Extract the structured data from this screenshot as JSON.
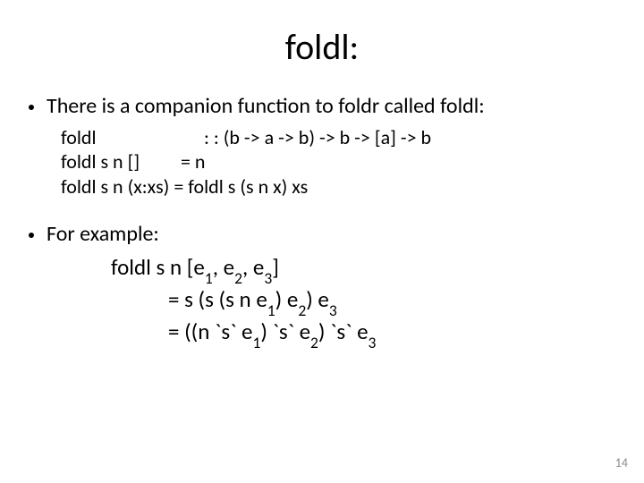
{
  "title": "foldl:",
  "bullet1": {
    "prefix": "There is a companion function to  ",
    "fn1": "foldr",
    "middle": " called ",
    "fn2": "foldl",
    "suffix": ":"
  },
  "code": {
    "l1a": "foldl",
    "l1b": ": : (b -> a -> b) -> b -> [a] -> b",
    "l2a": "foldl s n []",
    "l2b": "= n",
    "l3": "foldl s n (x:xs) = foldl s (s n x) xs"
  },
  "bullet2": "For example:",
  "example": {
    "e1_pre": "foldl s n [e",
    "e1_sub1": "1",
    "e1_mid1": ", e",
    "e1_sub2": "2",
    "e1_mid2": ", e",
    "e1_sub3": "3",
    "e1_post": "]",
    "e2_pre": "= s (s (s n e",
    "e2_sub1": "1",
    "e2_mid1": ") e",
    "e2_sub2": "2",
    "e2_mid2": ") e",
    "e2_sub3": "3",
    "e3_pre": "= ((n `s` e",
    "e3_sub1": "1",
    "e3_mid1": ") `s` e",
    "e3_sub2": "2",
    "e3_mid2": ") `s` e",
    "e3_sub3": "3"
  },
  "pageNumber": "14"
}
